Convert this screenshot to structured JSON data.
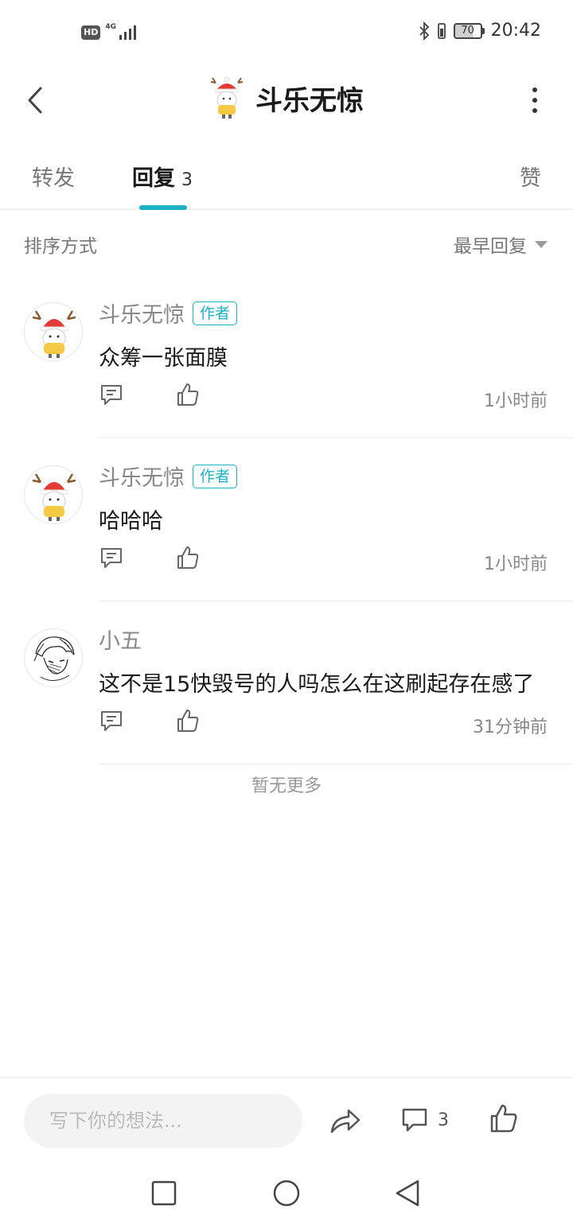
{
  "status_bar": {
    "hd": "HD",
    "network": "4G",
    "battery": "70",
    "battery_level_percent": 70,
    "time": "20:42"
  },
  "header": {
    "title": "斗乐无惊",
    "back_icon": "chevron-left-icon",
    "more_icon": "more-vertical-icon"
  },
  "tabs": {
    "forward": "转发",
    "reply": "回复",
    "reply_count": "3",
    "like": "赞",
    "active": "reply",
    "accent_color": "#1bb2c4"
  },
  "sort": {
    "label": "排序方式",
    "selected": "最早回复"
  },
  "comments": [
    {
      "name": "斗乐无惊",
      "badge": "作者",
      "text": "众筹一张面膜",
      "time": "1小时前"
    },
    {
      "name": "斗乐无惊",
      "badge": "作者",
      "text": "哈哈哈",
      "time": "1小时前"
    },
    {
      "name": "小五",
      "badge": "",
      "text": "这不是15快毁号的人吗怎么在这刷起存在感了",
      "time": "31分钟前"
    }
  ],
  "no_more": "暂无更多",
  "bottom_bar": {
    "input_placeholder": "写下你的想法...",
    "comment_count": "3"
  }
}
